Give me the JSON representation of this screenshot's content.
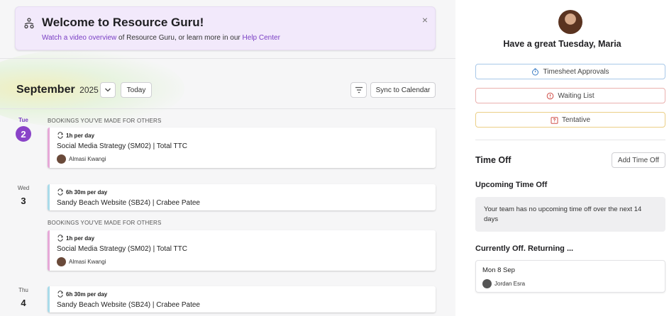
{
  "banner": {
    "title": "Welcome to Resource Guru!",
    "link_video": "Watch a video overview",
    "text_middle": " of Resource Guru, or learn more in our ",
    "link_help": "Help Center",
    "close_glyph": "×"
  },
  "calendar": {
    "month": "September",
    "year": "2025",
    "today_label": "Today",
    "sync_label": "Sync to Calendar"
  },
  "days": [
    {
      "dow": "Tue",
      "num": "2"
    },
    {
      "dow": "Wed",
      "num": "3"
    },
    {
      "dow": "Thu",
      "num": "4"
    }
  ],
  "section_label": "BOOKINGS YOU'VE MADE FOR OTHERS",
  "bookings": [
    {
      "rate": "1h per day",
      "project": "Social Media Strategy (SM02) | Total TTC",
      "person": "Almasi Kwangi"
    },
    {
      "rate": "6h 30m per day",
      "project": "Sandy Beach Website (SB24) | Crabee Patee"
    },
    {
      "rate": "1h per day",
      "project": "Social Media Strategy (SM02) | Total TTC",
      "person": "Almasi Kwangi"
    },
    {
      "rate": "6h 30m per day",
      "project": "Sandy Beach Website (SB24) | Crabee Patee"
    }
  ],
  "sidebar": {
    "greeting": "Have a great Tuesday, Maria",
    "timesheet": "Timesheet Approvals",
    "waiting": "Waiting List",
    "tentative": "Tentative",
    "time_off_title": "Time Off",
    "add_time_off": "Add Time Off",
    "upcoming_title": "Upcoming Time Off",
    "upcoming_empty": "Your team has no upcoming time off over the next 14 days",
    "currently_off_title": "Currently Off. Returning ...",
    "returning_date": "Mon 8 Sep",
    "returning_person": "Jordan Esra"
  },
  "colors": {
    "accent": "#8a43c8",
    "banner_bg": "#f2e9fb",
    "pink_bar": "#e6a8d8",
    "blue_bar": "#a9dbea"
  }
}
